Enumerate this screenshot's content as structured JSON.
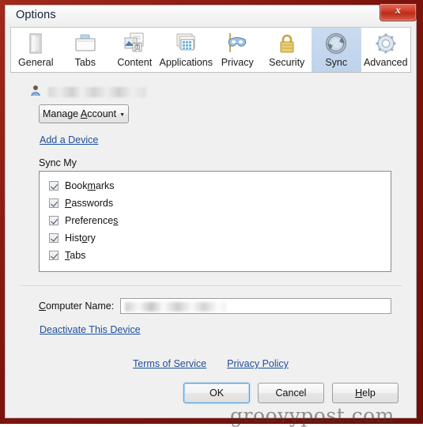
{
  "window": {
    "title": "Options",
    "close_label": "x",
    "border_color": "#8d1b12"
  },
  "tabs": [
    {
      "label": "General",
      "icon": "general-icon",
      "selected": false
    },
    {
      "label": "Tabs",
      "icon": "tabs-icon",
      "selected": false
    },
    {
      "label": "Content",
      "icon": "content-icon",
      "selected": false
    },
    {
      "label": "Applications",
      "icon": "applications-icon",
      "selected": false
    },
    {
      "label": "Privacy",
      "icon": "privacy-mask-icon",
      "selected": false
    },
    {
      "label": "Security",
      "icon": "security-lock-icon",
      "selected": false
    },
    {
      "label": "Sync",
      "icon": "sync-icon",
      "selected": true
    },
    {
      "label": "Advanced",
      "icon": "advanced-gear-icon",
      "selected": false
    }
  ],
  "account": {
    "name_value": "",
    "avatar_icon": "user-icon"
  },
  "manage_account": {
    "label_before": "Manage ",
    "accel": "A",
    "label_after": "ccount",
    "caret": "▼"
  },
  "links": {
    "add_device": "Add a Device",
    "deactivate": "Deactivate This Device",
    "terms_of_service": "Terms of Service",
    "privacy_policy": "Privacy Policy"
  },
  "sync_my": {
    "label": "Sync My",
    "items": [
      {
        "label_before": "Book",
        "accel": "m",
        "label_after": "arks",
        "checked": true
      },
      {
        "label_before": "",
        "accel": "P",
        "label_after": "asswords",
        "checked": true
      },
      {
        "label_before": "Preference",
        "accel": "s",
        "label_after": "",
        "checked": true
      },
      {
        "label_before": "Hist",
        "accel": "o",
        "label_after": "ry",
        "checked": true
      },
      {
        "label_before": "",
        "accel": "T",
        "label_after": "abs",
        "checked": true
      }
    ]
  },
  "computer_name": {
    "accel": "C",
    "label_after": "omputer Name:",
    "value": "",
    "placeholder": ""
  },
  "footer": {
    "ok": "OK",
    "cancel": "Cancel",
    "help_accel": "H",
    "help_after": "elp"
  },
  "watermark": {
    "text": "groovypost.com"
  },
  "colors": {
    "selected_tab": "#c4d8ef",
    "link": "#1c4f9c",
    "default_button_focus": "#5a9fd4",
    "panel_bg": "#f0f0f0"
  }
}
